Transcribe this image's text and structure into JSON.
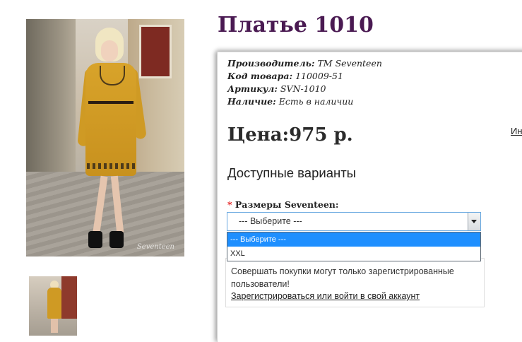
{
  "product": {
    "title": "Платье 1010",
    "photo_signature": "Seventeen"
  },
  "specs": [
    {
      "label": "Производитель:",
      "value": "ТМ Seventeen"
    },
    {
      "label": "Код товара:",
      "value": "110009-51"
    },
    {
      "label": "Артикул:",
      "value": "SVN-1010"
    },
    {
      "label": "Наличие:",
      "value": "Есть в наличии"
    }
  ],
  "price": {
    "text": "Цена:975 р."
  },
  "side_link": "Ин",
  "variants": {
    "heading": "Доступные варианты",
    "required_mark": "*",
    "size_label": "Размеры Seventeen:",
    "selected_value": "--- Выберите ---",
    "options": [
      "--- Выберите ---",
      "XXL"
    ]
  },
  "notice": {
    "message": "Совершать покупки могут только зарегистрированные пользователи!",
    "auth_link": "Зарегистрироваться или войти в свой аккаунт"
  },
  "icons": {
    "select_arrow": "chevron-down-icon"
  }
}
